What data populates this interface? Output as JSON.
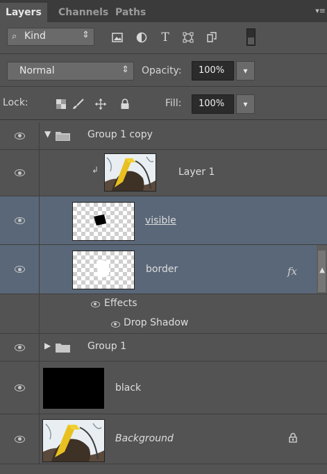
{
  "tabs": [
    {
      "label": "Layers",
      "active": true
    },
    {
      "label": "Channels",
      "active": false
    },
    {
      "label": "Paths",
      "active": false
    }
  ],
  "filter": {
    "kind_label": "Kind",
    "icons": [
      "pixel-filter-icon",
      "adjustment-filter-icon",
      "type-filter-icon",
      "shape-filter-icon",
      "smart-object-filter-icon"
    ]
  },
  "blend": {
    "mode": "Normal",
    "opacity_label": "Opacity:",
    "opacity_value": "100%"
  },
  "lock": {
    "label": "Lock:",
    "fill_label": "Fill:",
    "fill_value": "100%"
  },
  "layers": [
    {
      "name": "Group 1 copy",
      "type": "group",
      "expanded": true
    },
    {
      "name": "Layer 1",
      "type": "image",
      "clipped": true
    },
    {
      "name": "visible",
      "type": "pixel",
      "selected": true
    },
    {
      "name": "border",
      "type": "pixel",
      "selected": true,
      "fx": "fx"
    },
    {
      "name": "Effects",
      "type": "effects-header"
    },
    {
      "name": "Drop Shadow",
      "type": "effect"
    },
    {
      "name": "Group 1",
      "type": "group",
      "expanded": false
    },
    {
      "name": "black",
      "type": "fill"
    },
    {
      "name": "Background",
      "type": "background",
      "locked": true
    }
  ],
  "colors": {
    "panel_bg": "#535353",
    "selected_row": "#5a6778",
    "tab_bar": "#3b3b3b"
  }
}
